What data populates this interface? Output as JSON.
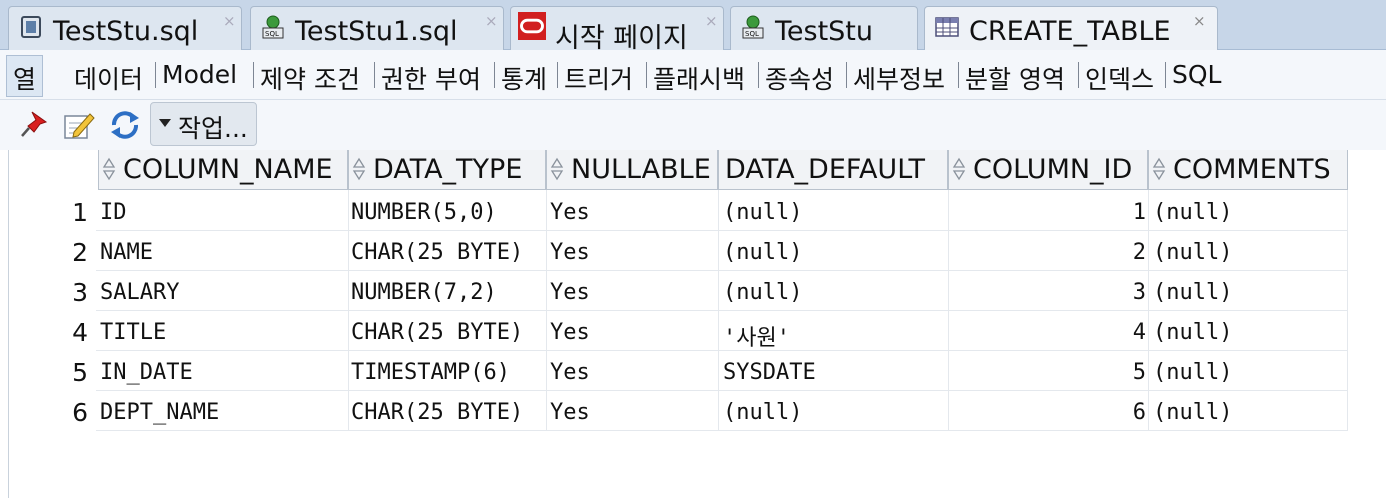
{
  "tabs": [
    {
      "label": "TestStu.sql",
      "icon": "sql-worksheet-icon"
    },
    {
      "label": "TestStu1.sql",
      "icon": "sql-connection-icon"
    },
    {
      "label": "시작 페이지",
      "icon": "oracle-icon"
    },
    {
      "label": "TestStu",
      "icon": "sql-connection-icon"
    },
    {
      "label": "CREATE_TABLE",
      "icon": "table-icon",
      "active": true
    }
  ],
  "close_glyph": "×",
  "subtabs": [
    "열",
    "데이터",
    "Model",
    "제약 조건",
    "권한 부여",
    "통계",
    "트리거",
    "플래시백",
    "종속성",
    "세부정보",
    "분할 영역",
    "인덱스",
    "SQL"
  ],
  "toolbar": {
    "action_label": "작업..."
  },
  "grid": {
    "columns": [
      "COLUMN_NAME",
      "DATA_TYPE",
      "NULLABLE",
      "DATA_DEFAULT",
      "COLUMN_ID",
      "COMMENTS"
    ],
    "rows": [
      {
        "n": "1",
        "name": "ID",
        "type": "NUMBER(5,0)",
        "nullable": "Yes",
        "default": "(null)",
        "id": "1",
        "comments": "(null)"
      },
      {
        "n": "2",
        "name": "NAME",
        "type": "CHAR(25 BYTE)",
        "nullable": "Yes",
        "default": "(null)",
        "id": "2",
        "comments": "(null)"
      },
      {
        "n": "3",
        "name": "SALARY",
        "type": "NUMBER(7,2)",
        "nullable": "Yes",
        "default": "(null)",
        "id": "3",
        "comments": "(null)"
      },
      {
        "n": "4",
        "name": "TITLE",
        "type": "CHAR(25 BYTE)",
        "nullable": "Yes",
        "default": "'사원'",
        "id": "4",
        "comments": "(null)"
      },
      {
        "n": "5",
        "name": "IN_DATE",
        "type": "TIMESTAMP(6)",
        "nullable": "Yes",
        "default": "SYSDATE",
        "id": "5",
        "comments": "(null)"
      },
      {
        "n": "6",
        "name": "DEPT_NAME",
        "type": "CHAR(25 BYTE)",
        "nullable": "Yes",
        "default": "(null)",
        "id": "6",
        "comments": "(null)"
      }
    ]
  },
  "colors": {
    "tabbar_bg": "#c7d6e8",
    "oracle_red": "#d11f1f",
    "pin_red": "#d81f1f"
  }
}
